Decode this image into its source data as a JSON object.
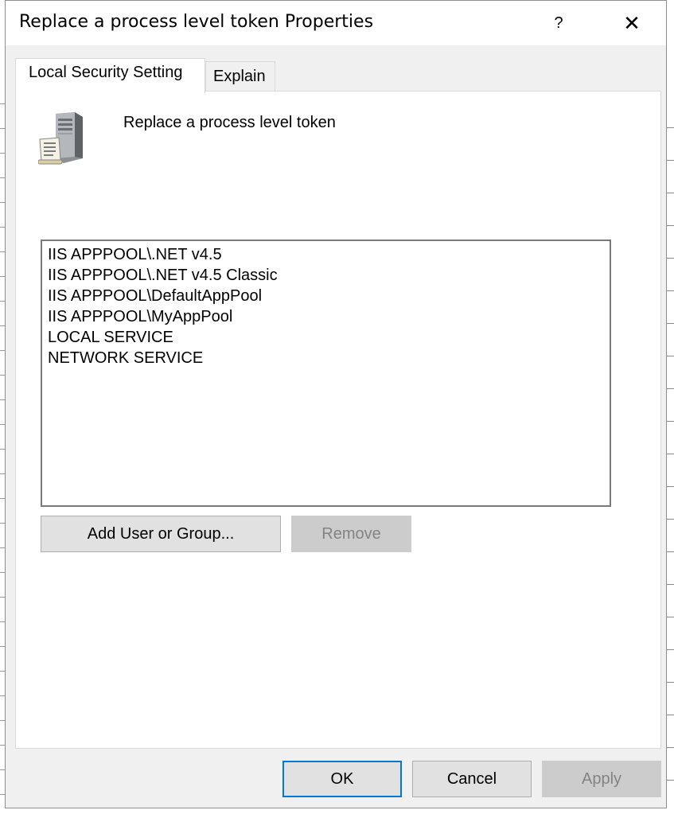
{
  "window": {
    "title": "Replace a process level token Properties",
    "help_label": "?",
    "close_label": "✕"
  },
  "tabs": [
    {
      "label": "Local Security Setting",
      "active": true
    },
    {
      "label": "Explain",
      "active": false
    }
  ],
  "policy": {
    "icon": "server-policy-icon",
    "name": "Replace a process level token"
  },
  "members": [
    "IIS APPPOOL\\.NET v4.5",
    "IIS APPPOOL\\.NET v4.5 Classic",
    "IIS APPPOOL\\DefaultAppPool",
    "IIS APPPOOL\\MyAppPool",
    "LOCAL SERVICE",
    "NETWORK SERVICE"
  ],
  "actions": {
    "add_label": "Add User or Group...",
    "remove_label": "Remove"
  },
  "footer": {
    "ok_label": "OK",
    "cancel_label": "Cancel",
    "apply_label": "Apply"
  },
  "colors": {
    "dialog_bg": "#f0f0f0",
    "focus_border": "#0078d7",
    "disabled_bg": "#cccccc",
    "disabled_text": "#838383"
  }
}
